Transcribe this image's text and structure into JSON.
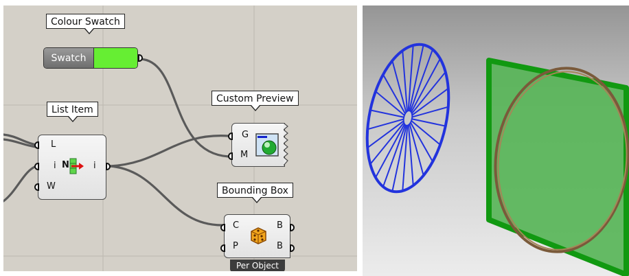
{
  "canvas": {
    "colour_swatch": {
      "tooltip": "Colour Swatch",
      "label": "Swatch",
      "color": "#66ee33"
    },
    "list_item": {
      "tooltip": "List Item",
      "inputs": [
        "L",
        "i",
        "W"
      ],
      "output": "i",
      "icon_letter": "N"
    },
    "custom_preview": {
      "tooltip": "Custom Preview",
      "inputs": [
        "G",
        "M"
      ]
    },
    "bounding_box": {
      "tooltip": "Bounding Box",
      "inputs": [
        "C",
        "P"
      ],
      "outputs": [
        "B",
        "B"
      ],
      "mode": "Per Object"
    }
  },
  "viewport": {
    "wheel_color": "#2233dd",
    "plane_color": "#119911",
    "ring_color": "#7a5a3a"
  }
}
